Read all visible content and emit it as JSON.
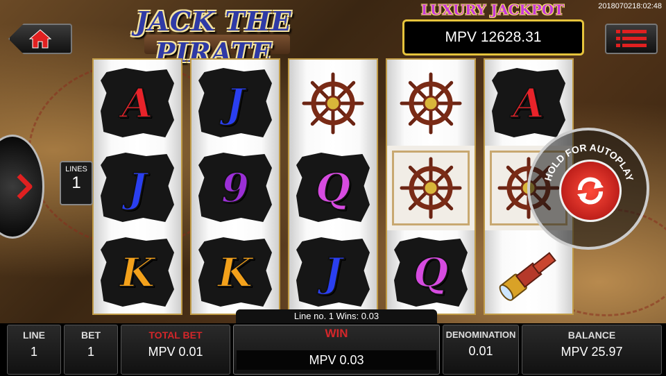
{
  "timestamp": "2018070218:02:48",
  "game_title": "JACK THE PIRATE",
  "jackpot": {
    "title": "LUXURY JACKPOT",
    "value": "MPV 12628.31"
  },
  "lines_panel": {
    "label": "LINES",
    "value": "1"
  },
  "autoplay_label": "HOLD FOR AUTOPLAY",
  "win_line_text": "Line no. 1 Wins: 0.03",
  "reels": [
    [
      "A",
      "J",
      "K"
    ],
    [
      "J",
      "9",
      "K"
    ],
    [
      "wheel",
      "Q",
      "J"
    ],
    [
      "wheel",
      "wheel",
      "Q"
    ],
    [
      "A",
      "wheel",
      "spyglass"
    ]
  ],
  "symbol_colors": {
    "A": "#e8232a",
    "J": "#2a3ff0",
    "K": "#f3a11b",
    "Q": "#d64be0",
    "9": "#9b2fd6"
  },
  "bottom_bar": {
    "line": {
      "label": "LINE",
      "value": "1"
    },
    "bet": {
      "label": "BET",
      "value": "1"
    },
    "total_bet": {
      "label": "TOTAL BET",
      "value": "MPV 0.01"
    },
    "win": {
      "label": "WIN",
      "value": "MPV 0.03"
    },
    "denomination": {
      "label": "DENOMINATION",
      "value": "0.01"
    },
    "balance": {
      "label": "BALANCE",
      "value": "MPV 25.97"
    }
  }
}
